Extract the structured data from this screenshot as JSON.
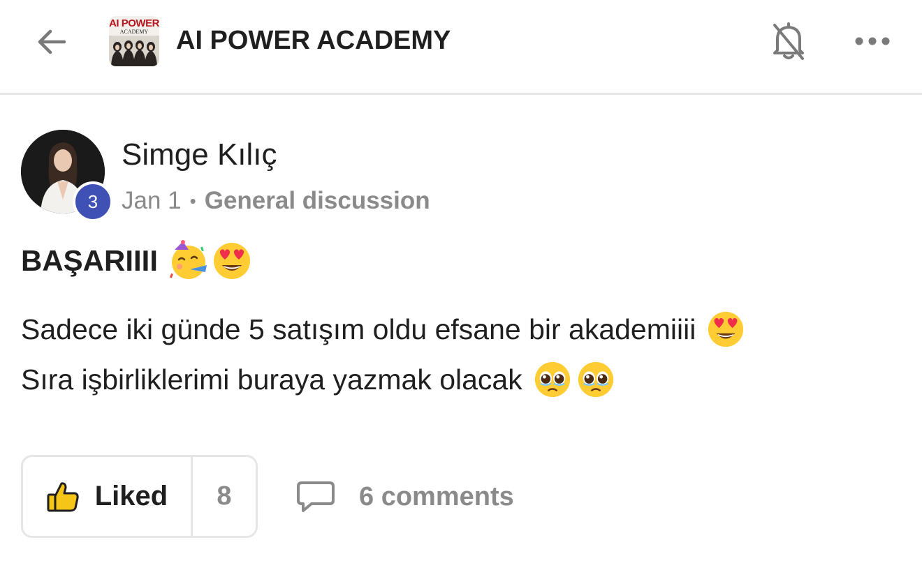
{
  "header": {
    "title": "AI POWER ACADEMY",
    "logo": {
      "line1": "AI POWER",
      "line2": "ACADEMY"
    },
    "back_icon": "arrow-left-icon",
    "bell_icon": "bell-off-icon",
    "more_icon": "more-horizontal-icon"
  },
  "post": {
    "author": {
      "name": "Simge Kılıç",
      "level": "3"
    },
    "date": "Jan 1",
    "separator": "•",
    "category": "General discussion",
    "title": "BAŞARIIII",
    "body_line1": "Sadece iki günde 5 satışım oldu efsane bir akademiiii",
    "body_line2": "Sıra işbirliklerimi buraya yazmak olacak",
    "actions": {
      "like_label": "Liked",
      "like_count": "8",
      "comments_label": "6 comments"
    }
  },
  "colors": {
    "badge": "#3f51b5",
    "muted_text": "#8a8a8a",
    "text": "#1f1f1f",
    "divider": "#e6e6e6",
    "logo_red": "#b8141d"
  }
}
